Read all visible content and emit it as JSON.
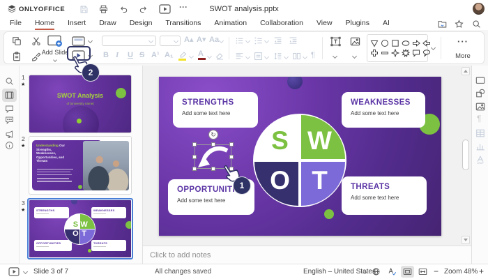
{
  "titlebar": {
    "brand": "ONLYOFFICE",
    "document_title": "SWOT analysis.pptx"
  },
  "menu": {
    "items": [
      "File",
      "Home",
      "Insert",
      "Draw",
      "Design",
      "Transitions",
      "Animation",
      "Collaboration",
      "View",
      "Plugins",
      "AI"
    ],
    "active_item": "Home"
  },
  "toolbar": {
    "add_slide_label": "Add Slide",
    "more_label": "More",
    "format": {
      "bold": "B",
      "italic": "I",
      "underline": "U",
      "strikeout": "S",
      "superscript": "A¹",
      "subscript": "A₁",
      "font_increase": "A▴",
      "font_decrease": "A▾",
      "change_case": "Aa",
      "font_color_letter": "A",
      "paragraph_mark": "¶"
    }
  },
  "icons": {
    "ellipsis": "···",
    "more_dots": "···",
    "star": "★",
    "rotate": "↻"
  },
  "slides_panel": {
    "slides": [
      {
        "number": "1",
        "title": "SWOT Analysis",
        "subtitle": "of [university name]"
      },
      {
        "number": "2",
        "title_lead": "Understanding",
        "title_rest": "Our Strengths, Weaknesses, Opportunities, and Threats"
      },
      {
        "number": "3",
        "selected": "true"
      }
    ]
  },
  "slide": {
    "boxes": {
      "strengths": {
        "title": "STRENGTHS",
        "body": "Add some text here"
      },
      "weaknesses": {
        "title": "WEAKNESSES",
        "body": "Add some text here"
      },
      "opportunities": {
        "title": "OPPORTUNITIES",
        "body": "Add some text here"
      },
      "threats": {
        "title": "THREATS",
        "body": "Add some text here"
      }
    },
    "wheel": {
      "s": "S",
      "w": "W",
      "o": "O",
      "t": "T"
    }
  },
  "annotations": {
    "step1": "1",
    "step2": "2"
  },
  "notes": {
    "placeholder": "Click to add notes"
  },
  "statusbar": {
    "slide_counter": "Slide 3 of 7",
    "save_status": "All changes saved",
    "language": "English – United States",
    "zoom": "Zoom 48%",
    "zoom_out": "−",
    "zoom_in": "+"
  },
  "colors": {
    "accent_navy": "#2e3264",
    "title_purple": "#5b35a5",
    "green": "#7cc142",
    "quadrant_dark": "#37306e",
    "quadrant_light": "#7b6ad8",
    "selection_blue": "#4a7fd6",
    "menu_underline": "#c55a45"
  }
}
